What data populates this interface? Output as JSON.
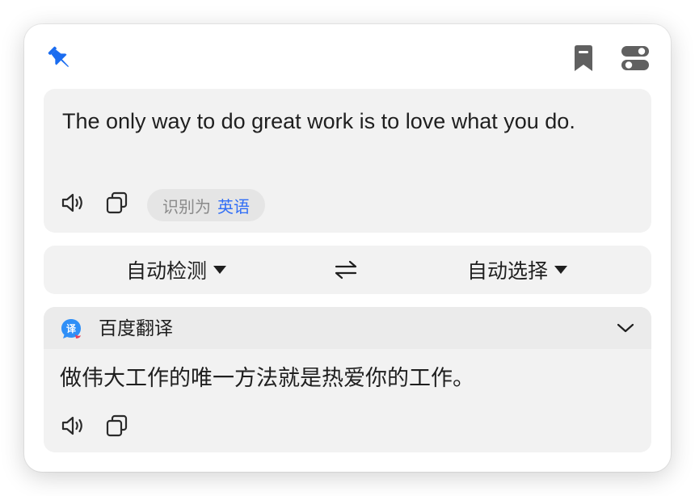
{
  "header": {
    "pin_icon": "pin-icon",
    "bookmark_icon": "bookmark-icon",
    "settings_icon": "toggle-settings-icon",
    "accent_color": "#1a73e8"
  },
  "source": {
    "text": "The only way to do great work is to love what you do.",
    "detected_prefix": "识别为",
    "detected_language": "英语"
  },
  "languages": {
    "from": "自动检测",
    "to": "自动选择",
    "swap_icon": "swap-arrows-icon"
  },
  "result": {
    "engine_name": "百度翻译",
    "engine_logo_glyph": "译",
    "text": "做伟大工作的唯一方法就是热爱你的工作。"
  }
}
